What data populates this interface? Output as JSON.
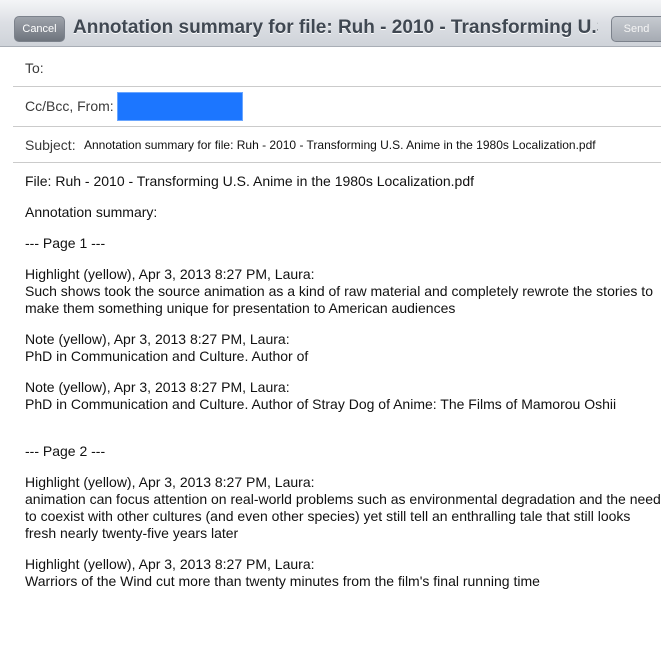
{
  "header": {
    "cancel_label": "Cancel",
    "title": "Annotation summary for file: Ruh - 2010 - Transforming U.S....",
    "send_label": "Send"
  },
  "fields": {
    "to_label": "To:",
    "cc_label": "Cc/Bcc, From:",
    "subject_label": "Subject:",
    "subject_value": "Annotation summary for file: Ruh - 2010 - Transforming U.S. Anime in the 1980s Localization.pdf"
  },
  "body": {
    "file_line": "File: Ruh - 2010 - Transforming U.S. Anime in the 1980s Localization.pdf",
    "summary_heading": "Annotation summary:",
    "page1_heading": "--- Page 1 ---",
    "a1_header": "Highlight (yellow), Apr 3, 2013 8:27 PM, Laura:",
    "a1_text": "Such shows took the source animation as a kind of raw material and completely rewrote the stories to make them something unique for presentation to American audiences",
    "a2_header": "Note (yellow), Apr 3, 2013 8:27 PM, Laura:",
    "a2_text": "PhD in Communication and Culture.  Author of",
    "a3_header": "Note (yellow), Apr 3, 2013 8:27 PM, Laura:",
    "a3_text": "PhD in Communication and Culture.  Author of Stray Dog of Anime: The Films of Mamorou Oshii",
    "page2_heading": "--- Page 2 ---",
    "a4_header": "Highlight (yellow), Apr 3, 2013 8:27 PM, Laura:",
    "a4_text": "animation can focus attention on real-world problems such as environmental degradation and the need to coexist with other cultures (and even other species) yet still tell an enthralling tale that still looks fresh nearly twenty-five years later",
    "a5_header": "Highlight (yellow), Apr 3, 2013 8:27 PM, Laura:",
    "a5_text": "Warriors of the Wind cut more than twenty minutes from the film's final running time"
  },
  "colors": {
    "from_highlight": "#1c76ff",
    "title_text": "#404852"
  }
}
